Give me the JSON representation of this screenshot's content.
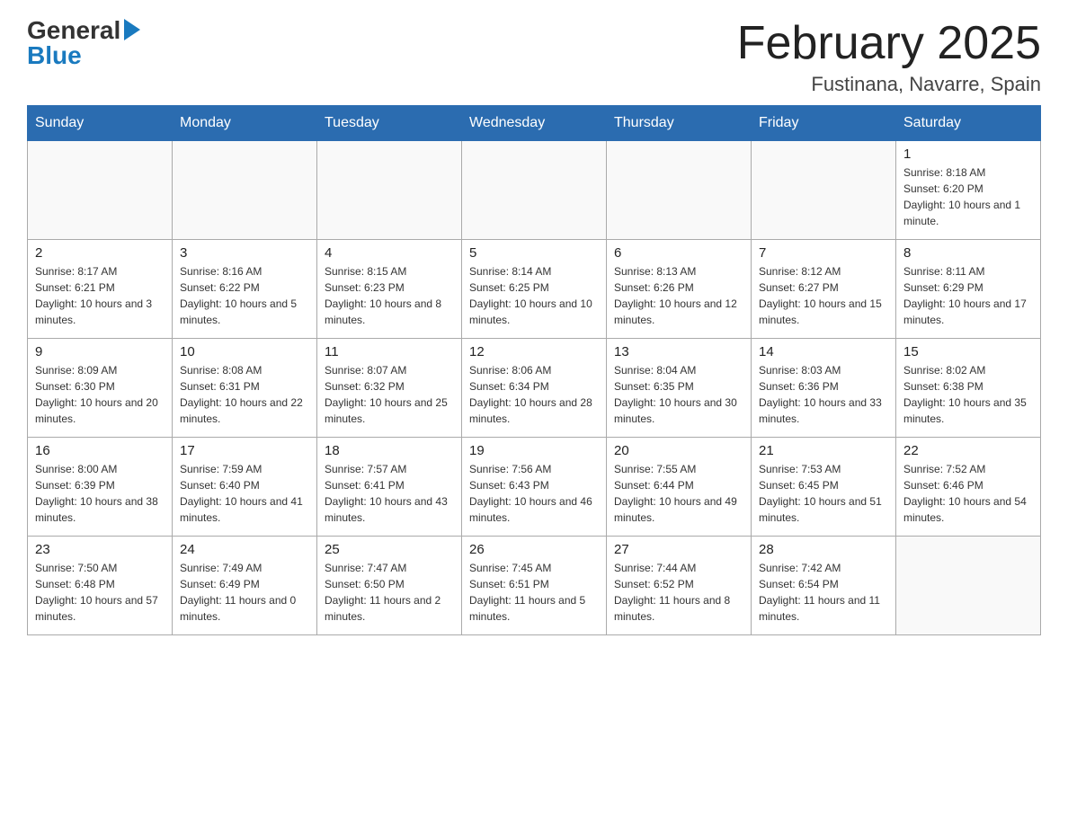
{
  "header": {
    "logo_general": "General",
    "logo_blue": "Blue",
    "title": "February 2025",
    "location": "Fustinana, Navarre, Spain"
  },
  "days_of_week": [
    "Sunday",
    "Monday",
    "Tuesday",
    "Wednesday",
    "Thursday",
    "Friday",
    "Saturday"
  ],
  "weeks": [
    [
      {
        "day": "",
        "info": ""
      },
      {
        "day": "",
        "info": ""
      },
      {
        "day": "",
        "info": ""
      },
      {
        "day": "",
        "info": ""
      },
      {
        "day": "",
        "info": ""
      },
      {
        "day": "",
        "info": ""
      },
      {
        "day": "1",
        "info": "Sunrise: 8:18 AM\nSunset: 6:20 PM\nDaylight: 10 hours and 1 minute."
      }
    ],
    [
      {
        "day": "2",
        "info": "Sunrise: 8:17 AM\nSunset: 6:21 PM\nDaylight: 10 hours and 3 minutes."
      },
      {
        "day": "3",
        "info": "Sunrise: 8:16 AM\nSunset: 6:22 PM\nDaylight: 10 hours and 5 minutes."
      },
      {
        "day": "4",
        "info": "Sunrise: 8:15 AM\nSunset: 6:23 PM\nDaylight: 10 hours and 8 minutes."
      },
      {
        "day": "5",
        "info": "Sunrise: 8:14 AM\nSunset: 6:25 PM\nDaylight: 10 hours and 10 minutes."
      },
      {
        "day": "6",
        "info": "Sunrise: 8:13 AM\nSunset: 6:26 PM\nDaylight: 10 hours and 12 minutes."
      },
      {
        "day": "7",
        "info": "Sunrise: 8:12 AM\nSunset: 6:27 PM\nDaylight: 10 hours and 15 minutes."
      },
      {
        "day": "8",
        "info": "Sunrise: 8:11 AM\nSunset: 6:29 PM\nDaylight: 10 hours and 17 minutes."
      }
    ],
    [
      {
        "day": "9",
        "info": "Sunrise: 8:09 AM\nSunset: 6:30 PM\nDaylight: 10 hours and 20 minutes."
      },
      {
        "day": "10",
        "info": "Sunrise: 8:08 AM\nSunset: 6:31 PM\nDaylight: 10 hours and 22 minutes."
      },
      {
        "day": "11",
        "info": "Sunrise: 8:07 AM\nSunset: 6:32 PM\nDaylight: 10 hours and 25 minutes."
      },
      {
        "day": "12",
        "info": "Sunrise: 8:06 AM\nSunset: 6:34 PM\nDaylight: 10 hours and 28 minutes."
      },
      {
        "day": "13",
        "info": "Sunrise: 8:04 AM\nSunset: 6:35 PM\nDaylight: 10 hours and 30 minutes."
      },
      {
        "day": "14",
        "info": "Sunrise: 8:03 AM\nSunset: 6:36 PM\nDaylight: 10 hours and 33 minutes."
      },
      {
        "day": "15",
        "info": "Sunrise: 8:02 AM\nSunset: 6:38 PM\nDaylight: 10 hours and 35 minutes."
      }
    ],
    [
      {
        "day": "16",
        "info": "Sunrise: 8:00 AM\nSunset: 6:39 PM\nDaylight: 10 hours and 38 minutes."
      },
      {
        "day": "17",
        "info": "Sunrise: 7:59 AM\nSunset: 6:40 PM\nDaylight: 10 hours and 41 minutes."
      },
      {
        "day": "18",
        "info": "Sunrise: 7:57 AM\nSunset: 6:41 PM\nDaylight: 10 hours and 43 minutes."
      },
      {
        "day": "19",
        "info": "Sunrise: 7:56 AM\nSunset: 6:43 PM\nDaylight: 10 hours and 46 minutes."
      },
      {
        "day": "20",
        "info": "Sunrise: 7:55 AM\nSunset: 6:44 PM\nDaylight: 10 hours and 49 minutes."
      },
      {
        "day": "21",
        "info": "Sunrise: 7:53 AM\nSunset: 6:45 PM\nDaylight: 10 hours and 51 minutes."
      },
      {
        "day": "22",
        "info": "Sunrise: 7:52 AM\nSunset: 6:46 PM\nDaylight: 10 hours and 54 minutes."
      }
    ],
    [
      {
        "day": "23",
        "info": "Sunrise: 7:50 AM\nSunset: 6:48 PM\nDaylight: 10 hours and 57 minutes."
      },
      {
        "day": "24",
        "info": "Sunrise: 7:49 AM\nSunset: 6:49 PM\nDaylight: 11 hours and 0 minutes."
      },
      {
        "day": "25",
        "info": "Sunrise: 7:47 AM\nSunset: 6:50 PM\nDaylight: 11 hours and 2 minutes."
      },
      {
        "day": "26",
        "info": "Sunrise: 7:45 AM\nSunset: 6:51 PM\nDaylight: 11 hours and 5 minutes."
      },
      {
        "day": "27",
        "info": "Sunrise: 7:44 AM\nSunset: 6:52 PM\nDaylight: 11 hours and 8 minutes."
      },
      {
        "day": "28",
        "info": "Sunrise: 7:42 AM\nSunset: 6:54 PM\nDaylight: 11 hours and 11 minutes."
      },
      {
        "day": "",
        "info": ""
      }
    ]
  ],
  "accent_color": "#2b6cb0"
}
